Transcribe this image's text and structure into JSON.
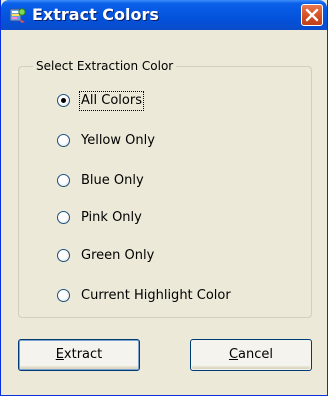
{
  "window": {
    "title": "Extract Colors",
    "close_icon": "close-icon",
    "app_icon": "app-icon"
  },
  "group": {
    "legend": "Select Extraction Color",
    "options": [
      {
        "label": "All Colors",
        "checked": true
      },
      {
        "label": "Yellow Only",
        "checked": false
      },
      {
        "label": "Blue Only",
        "checked": false
      },
      {
        "label": "Pink Only",
        "checked": false
      },
      {
        "label": "Green Only",
        "checked": false
      },
      {
        "label": "Current Highlight Color",
        "checked": false
      }
    ]
  },
  "buttons": {
    "extract_mnemonic": "E",
    "extract_rest": "xtract",
    "cancel_mnemonic": "C",
    "cancel_rest": "ancel"
  },
  "colors": {
    "title_bar": "#0a5fe8",
    "window_bg": "#ece9d8",
    "close_button": "#d24e21",
    "button_border": "#003c74"
  }
}
